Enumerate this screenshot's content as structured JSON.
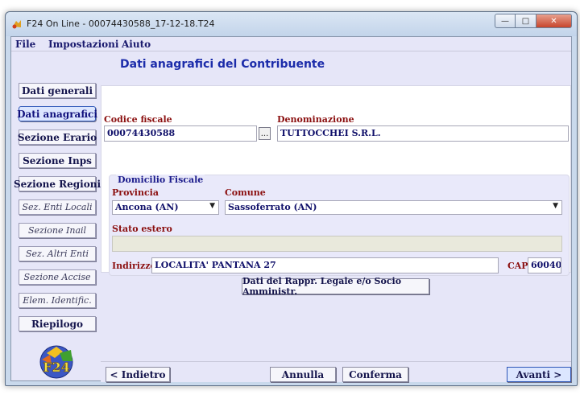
{
  "window": {
    "title": "F24 On Line - 00074430588_17-12-18.T24",
    "minimize": "—",
    "maximize": "□",
    "close": "✕"
  },
  "menu": [
    "File",
    "Impostazioni",
    "Aiuto"
  ],
  "page_title": "Dati anagrafici del Contribuente",
  "sidebar": [
    {
      "label": "Dati generali"
    },
    {
      "label": "Dati anagrafici"
    },
    {
      "label": "Sezione Erario"
    },
    {
      "label": "Sezione Inps"
    },
    {
      "label": "Sezione Regioni"
    },
    {
      "label": "Sez. Enti Locali"
    },
    {
      "label": "Sezione Inail"
    },
    {
      "label": "Sez. Altri Enti"
    },
    {
      "label": "Sezione Accise"
    },
    {
      "label": "Elem. Identific."
    },
    {
      "label": "Riepilogo"
    }
  ],
  "form": {
    "codice_fiscale_label": "Codice fiscale",
    "codice_fiscale_value": "00074430588",
    "lookup_button": "...",
    "denominazione_label": "Denominazione",
    "denominazione_value": "TUTTOCCHEI S.R.L.",
    "domicilio_title": "Domicilio Fiscale",
    "provincia_label": "Provincia",
    "provincia_value": "Ancona (AN)",
    "comune_label": "Comune",
    "comune_value": "Sassoferrato (AN)",
    "stato_estero_label": "Stato estero",
    "stato_estero_value": "",
    "indirizzo_label": "Indirizzo",
    "indirizzo_value": "LOCALITA' PANTANA 27",
    "cap_label": "CAP",
    "cap_value": "60040"
  },
  "rappr_button": "Dati del Rappr. Legale e/o Socio Amministr.",
  "nav": {
    "back": "< Indietro",
    "cancel": "Annulla",
    "confirm": "Conferma",
    "next": "Avanti >"
  },
  "logo_text": "F24",
  "colors": {
    "accent": "#1c2caa",
    "label_red": "#8b1010",
    "client_bg": "#e6e6f8"
  }
}
